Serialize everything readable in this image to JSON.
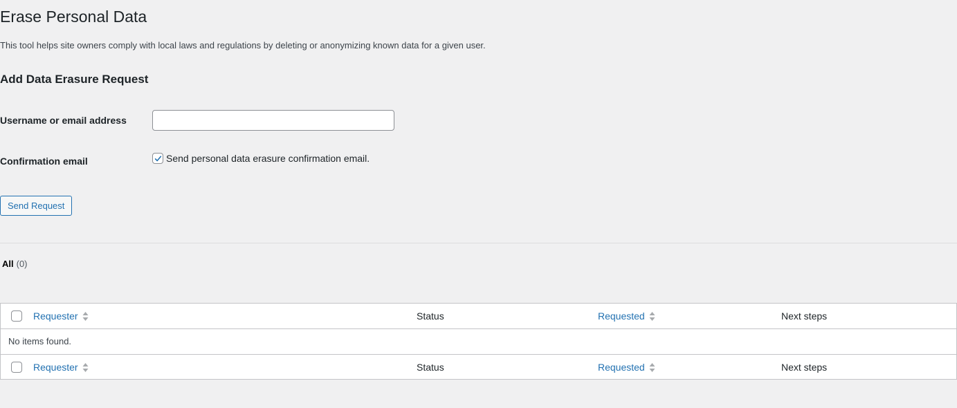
{
  "page": {
    "title": "Erase Personal Data",
    "description": "This tool helps site owners comply with local laws and regulations by deleting or anonymizing known data for a given user."
  },
  "form": {
    "section_title": "Add Data Erasure Request",
    "username_label": "Username or email address",
    "username_value": "",
    "confirm_label": "Confirmation email",
    "confirm_checkbox_label": "Send personal data erasure confirmation email.",
    "confirm_checked": true,
    "send_button": "Send Request"
  },
  "filters": {
    "all_label": "All",
    "all_count": "(0)"
  },
  "table": {
    "columns": {
      "requester": "Requester",
      "status": "Status",
      "requested": "Requested",
      "next_steps": "Next steps"
    },
    "empty_message": "No items found."
  },
  "icons": {
    "checkmark": "check-icon",
    "sort": "sort-arrows-icon"
  },
  "colors": {
    "link": "#2271b1",
    "background": "#f0f0f1",
    "border": "#c3c4c7"
  }
}
